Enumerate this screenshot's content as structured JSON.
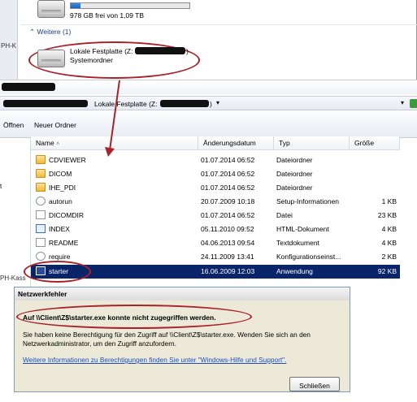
{
  "top_pane": {
    "drive_header_fragment": "",
    "drive_free_text": "978 GB frei von 1,09 TB",
    "drive_used_fraction": 0.08,
    "left_label": "PH-K",
    "group_label": "Weitere (1)",
    "network_drive": {
      "name": "Lokale Festplatte (Z:",
      "name_tail": ")",
      "type": "Systemordner"
    }
  },
  "window": {
    "address_crumb": "Lokale Festplatte (Z:",
    "address_crumb_tail": ")",
    "address_chevron": "▾",
    "toolbar": {
      "open_label": "Öffnen",
      "new_folder_label": "Neuer Ordner"
    },
    "columns": {
      "name": "Name",
      "date": "Änderungsdatum",
      "type": "Typ",
      "size": "Größe"
    },
    "files": [
      {
        "name": "CDVIEWER",
        "date": "01.07.2014 06:52",
        "type": "Dateiordner",
        "size": "",
        "icon": "folder-icon"
      },
      {
        "name": "DICOM",
        "date": "01.07.2014 06:52",
        "type": "Dateiordner",
        "size": "",
        "icon": "folder-icon"
      },
      {
        "name": "IHE_PDI",
        "date": "01.07.2014 06:52",
        "type": "Dateiordner",
        "size": "",
        "icon": "folder-icon"
      },
      {
        "name": "autorun",
        "date": "20.07.2009 10:18",
        "type": "Setup-Informationen",
        "size": "1 KB",
        "icon": "settings-file-icon"
      },
      {
        "name": "DICOMDIR",
        "date": "01.07.2014 06:52",
        "type": "Datei",
        "size": "23 KB",
        "icon": "file-icon"
      },
      {
        "name": "INDEX",
        "date": "05.11.2010 09:52",
        "type": "HTML-Dokument",
        "size": "4 KB",
        "icon": "html-file-icon"
      },
      {
        "name": "README",
        "date": "04.06.2013 09:54",
        "type": "Textdokument",
        "size": "4 KB",
        "icon": "text-file-icon"
      },
      {
        "name": "require",
        "date": "24.11.2009 13:41",
        "type": "Konfigurationseinst...",
        "size": "2 KB",
        "icon": "settings-file-icon"
      },
      {
        "name": "starter",
        "date": "16.06.2009 12:03",
        "type": "Anwendung",
        "size": "92 KB",
        "icon": "application-icon",
        "selected": true
      }
    ],
    "left_label_bottom": "PH-Kass"
  },
  "dialog": {
    "title": "Netzwerkfehler",
    "error_text": "Auf \\\\Client\\Z$\\starter.exe konnte nicht zugegriffen werden.",
    "detail_text": "Sie haben keine Berechtigung für den Zugriff auf \\\\Client\\Z$\\starter.exe. Wenden Sie sich an den Netzwerkadministrator, um den Zugriff anzufordern.",
    "help_link": "Weitere Informationen zu Berechtigungen finden Sie unter \"Windows-Hilfe und Support\".",
    "close_button": "Schließen"
  },
  "colors": {
    "annotation_red": "#a8222a",
    "selection_blue": "#0a246a"
  }
}
